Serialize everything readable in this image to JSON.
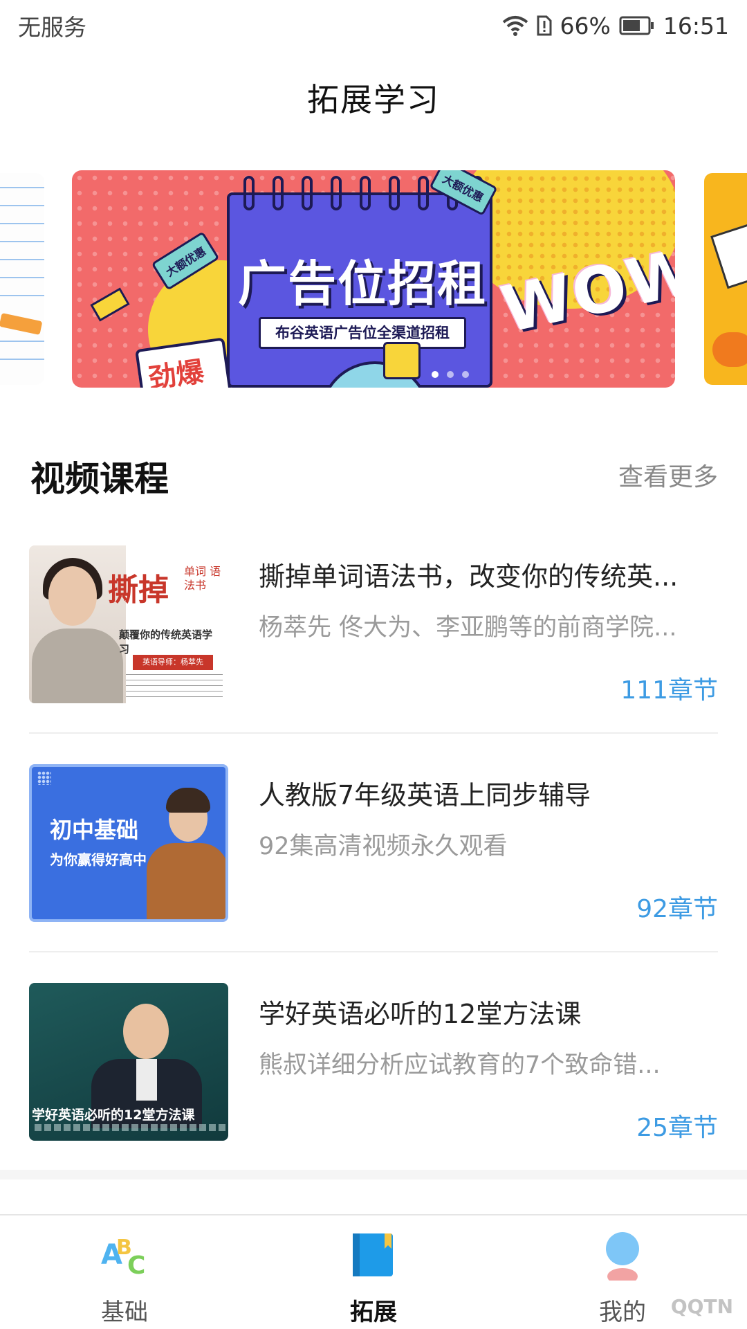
{
  "status_bar": {
    "carrier": "无服务",
    "battery_percent": "66%",
    "time": "16:51"
  },
  "header": {
    "title": "拓展学习"
  },
  "banner": {
    "headline": "广告位招租",
    "subtitle": "布谷英语广告位全渠道招租",
    "promo_tag": "大额优惠",
    "wow": "WOW",
    "burst": "劲爆"
  },
  "video_section": {
    "title": "视频课程",
    "more_label": "查看更多",
    "courses": [
      {
        "title": "撕掉单词语法书，改变你的传统英...",
        "desc": "杨萃先 佟大为、李亚鹏等的前商学院...",
        "chapters": "111章节",
        "thumb": {
          "big": "撕掉",
          "small": "单词 语法书",
          "tagline": "颠覆你的传统英语学习",
          "mentor": "英语导师：杨萃先"
        }
      },
      {
        "title": "人教版7年级英语上同步辅导",
        "desc": "92集高清视频永久观看",
        "chapters": "92章节",
        "thumb": {
          "line1": "初中基础",
          "line2": "为你赢得好高中"
        }
      },
      {
        "title": "学好英语必听的12堂方法课",
        "desc": "熊叔详细分析应试教育的7个致命错...",
        "chapters": "25章节",
        "thumb": {
          "caption": "学好英语必听的12堂方法课"
        }
      }
    ]
  },
  "tab_bar": {
    "tabs": [
      {
        "label": "基础",
        "icon": "abc-icon"
      },
      {
        "label": "拓展",
        "icon": "book-icon"
      },
      {
        "label": "我的",
        "icon": "user-icon"
      }
    ],
    "active_index": 1
  },
  "watermark": "QQTN"
}
